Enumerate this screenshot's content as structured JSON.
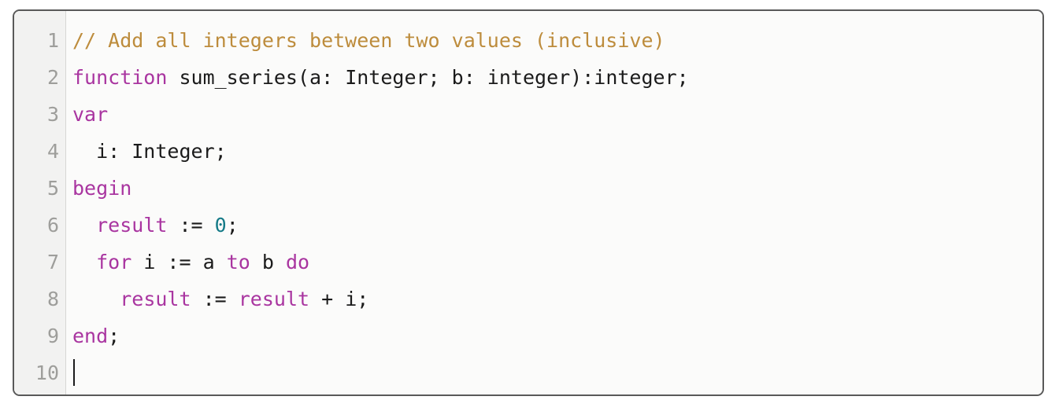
{
  "editor": {
    "language": "pascal",
    "theme_colors": {
      "background": "#fbfbfa",
      "gutter_background": "#f2f2f1",
      "gutter_text": "#9e9e9b",
      "border": "#595959",
      "comment": "#bd8c3c",
      "keyword": "#a935a0",
      "builtin": "#a935a0",
      "number": "#147a87",
      "plain_text": "#1b1b1b",
      "caret": "#1b1b1b"
    },
    "cursor": {
      "line": 10,
      "column": 1,
      "glyph": "text-caret"
    },
    "line_numbers": [
      "1",
      "2",
      "3",
      "4",
      "5",
      "6",
      "7",
      "8",
      "9",
      "10"
    ],
    "lines": [
      {
        "number": "1",
        "text": "// Add all integers between two values (inclusive)",
        "tokens": [
          {
            "t": "// Add all integers between two values (inclusive)",
            "c": "comment"
          }
        ]
      },
      {
        "number": "2",
        "text": "function sum_series(a: Integer; b: integer):integer;",
        "tokens": [
          {
            "t": "function",
            "c": "keyword"
          },
          {
            "t": " sum_series(a: Integer; b: integer):integer;",
            "c": "plain"
          }
        ]
      },
      {
        "number": "3",
        "text": "var",
        "tokens": [
          {
            "t": "var",
            "c": "keyword"
          }
        ]
      },
      {
        "number": "4",
        "text": "  i: Integer;",
        "tokens": [
          {
            "t": "  i: Integer;",
            "c": "plain"
          }
        ]
      },
      {
        "number": "5",
        "text": "begin",
        "tokens": [
          {
            "t": "begin",
            "c": "keyword"
          }
        ]
      },
      {
        "number": "6",
        "text": "  result := 0;",
        "tokens": [
          {
            "t": "  ",
            "c": "plain"
          },
          {
            "t": "result",
            "c": "builtin"
          },
          {
            "t": " := ",
            "c": "plain"
          },
          {
            "t": "0",
            "c": "number"
          },
          {
            "t": ";",
            "c": "plain"
          }
        ]
      },
      {
        "number": "7",
        "text": "  for i := a to b do",
        "tokens": [
          {
            "t": "  ",
            "c": "plain"
          },
          {
            "t": "for",
            "c": "keyword"
          },
          {
            "t": " i := a ",
            "c": "plain"
          },
          {
            "t": "to",
            "c": "keyword"
          },
          {
            "t": " b ",
            "c": "plain"
          },
          {
            "t": "do",
            "c": "keyword"
          }
        ]
      },
      {
        "number": "8",
        "text": "    result := result + i;",
        "tokens": [
          {
            "t": "    ",
            "c": "plain"
          },
          {
            "t": "result",
            "c": "builtin"
          },
          {
            "t": " := ",
            "c": "plain"
          },
          {
            "t": "result",
            "c": "builtin"
          },
          {
            "t": " + i;",
            "c": "plain"
          }
        ]
      },
      {
        "number": "9",
        "text": "end;",
        "tokens": [
          {
            "t": "end",
            "c": "keyword"
          },
          {
            "t": ";",
            "c": "plain"
          }
        ]
      },
      {
        "number": "10",
        "text": "",
        "tokens": [],
        "has_caret": true
      }
    ]
  }
}
